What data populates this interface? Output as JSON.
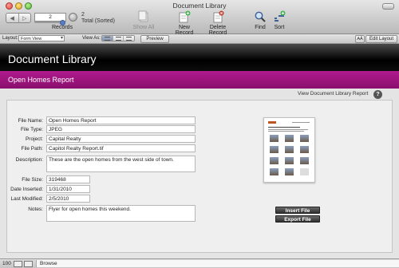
{
  "window": {
    "title": "Document Library"
  },
  "toolbar": {
    "record_number": "2",
    "record_count": "2",
    "record_status": "Total (Sorted)",
    "records_label": "Records",
    "show_all": "Show All",
    "new_record": "New Record",
    "delete_record": "Delete Record",
    "find": "Find",
    "sort": "Sort"
  },
  "layoutbar": {
    "layout_label": "Layout:",
    "layout_value": "Form View",
    "view_as_label": "View As:",
    "preview": "Preview",
    "aa": "AÂ",
    "edit_layout": "Edit Layout"
  },
  "header": {
    "title": "Document Library",
    "subtitle": "Open Homes Report",
    "view_link": "View Document Library Report",
    "help": "?"
  },
  "form": {
    "file_name_label": "File Name:",
    "file_name": "Open Homes Report",
    "file_type_label": "File Type:",
    "file_type": "JPEG",
    "project_label": "Project:",
    "project": "Capital Realty",
    "file_path_label": "File Path:",
    "file_path": "Capitol Realty Report.tif",
    "description_label": "Description:",
    "description": "These are the open homes from the west side of town.",
    "file_size_label": "File Size:",
    "file_size": "319468",
    "date_inserted_label": "Date Inserted:",
    "date_inserted": "1/31/2010",
    "last_modified_label": "Last Modified:",
    "last_modified": "2/5/2010",
    "notes_label": "Notes:",
    "notes": "Flyer for open homes this weekend."
  },
  "actions": {
    "insert_file": "Insert File",
    "export_file": "Export File"
  },
  "statusbar": {
    "zoom": "100",
    "mode": "Browse"
  }
}
